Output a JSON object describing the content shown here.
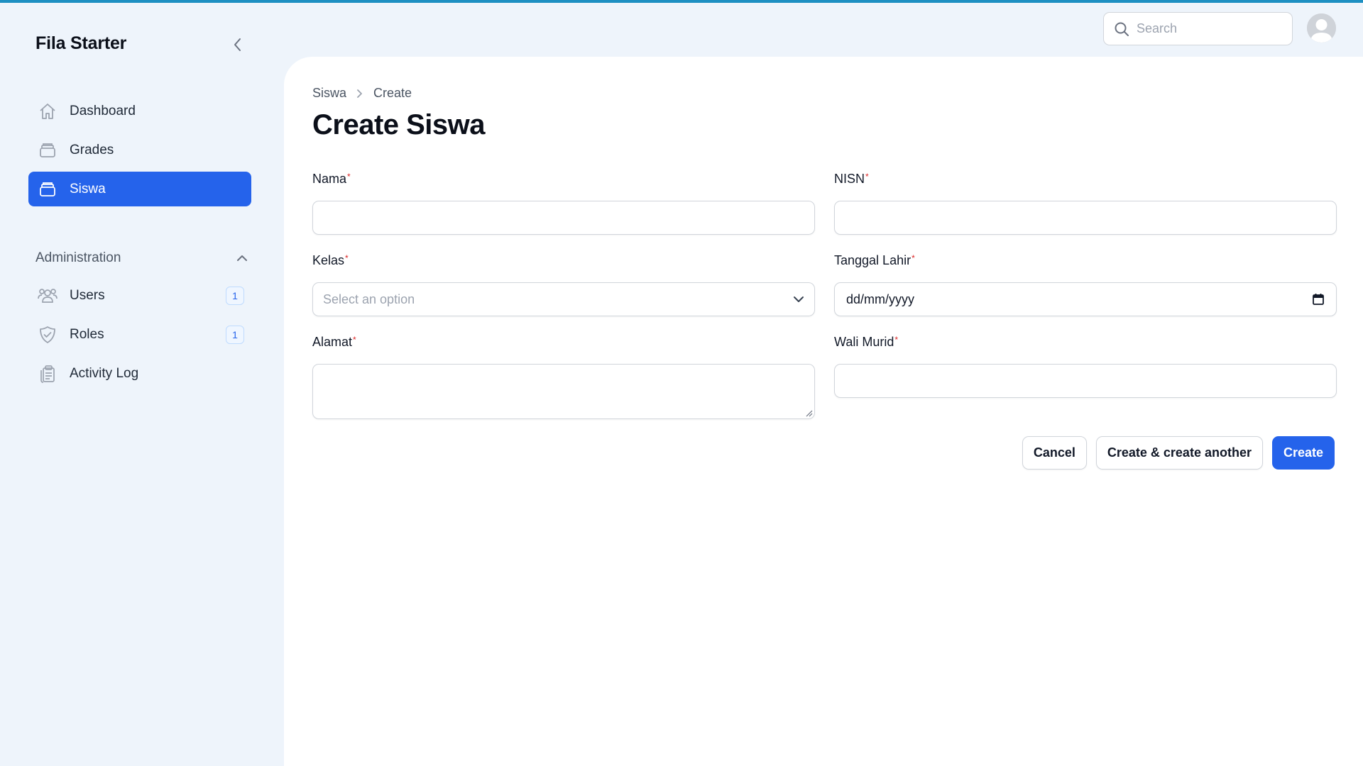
{
  "app": {
    "brand": "Fila Starter",
    "accent_color": "#2563eb",
    "top_bar_color": "#1d8fc2"
  },
  "sidebar": {
    "items": [
      {
        "label": "Dashboard",
        "icon": "home-icon"
      },
      {
        "label": "Grades",
        "icon": "stack-icon"
      },
      {
        "label": "Siswa",
        "icon": "stack-icon",
        "active": true
      }
    ],
    "group": {
      "label": "Administration",
      "items": [
        {
          "label": "Users",
          "icon": "users-icon",
          "badge": "1"
        },
        {
          "label": "Roles",
          "icon": "shield-check-icon",
          "badge": "1"
        },
        {
          "label": "Activity Log",
          "icon": "clipboard-icon"
        }
      ]
    }
  },
  "topbar": {
    "search_placeholder": "Search"
  },
  "breadcrumb": [
    "Siswa",
    "Create"
  ],
  "page": {
    "title": "Create Siswa"
  },
  "form": {
    "nama": {
      "label": "Nama",
      "value": ""
    },
    "nisn": {
      "label": "NISN",
      "value": ""
    },
    "kelas": {
      "label": "Kelas",
      "placeholder": "Select an option"
    },
    "tanggal_lahir": {
      "label": "Tanggal Lahir",
      "display": "dd/mm/yyyy"
    },
    "alamat": {
      "label": "Alamat",
      "value": ""
    },
    "wali_murid": {
      "label": "Wali Murid",
      "value": ""
    }
  },
  "actions": {
    "cancel": "Cancel",
    "create_another": "Create & create another",
    "create": "Create"
  }
}
